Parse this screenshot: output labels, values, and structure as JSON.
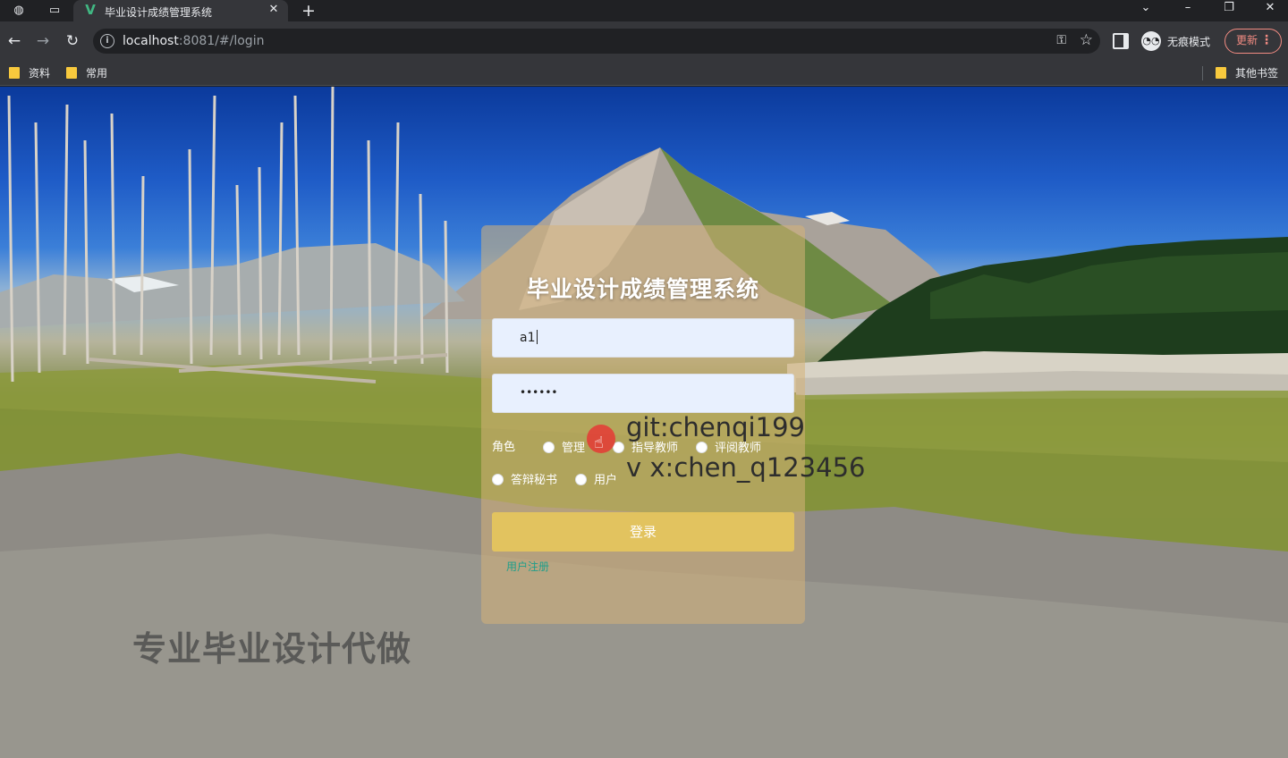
{
  "browser": {
    "tab_title": "毕业设计成绩管理系统",
    "url_host": "localhost",
    "url_rest": ":8081/#/login",
    "incognito_label": "无痕模式",
    "update_label": "更新",
    "bookmarks": [
      "资料",
      "常用"
    ],
    "other_bookmarks": "其他书签"
  },
  "login": {
    "title": "毕业设计成绩管理系统",
    "username_value": "a1",
    "password_value": "••••••",
    "role_label": "角色",
    "roles": [
      "管理",
      "指导教师",
      "评阅教师",
      "答辩秘书",
      "用户"
    ],
    "login_button": "登录",
    "register_link": "用户注册"
  },
  "watermarks": {
    "git": "git:chenqi199",
    "vx": "v x:chen_q123456",
    "ad": "专业毕业设计代做"
  },
  "colors": {
    "card": "#d6b278",
    "login_button": "#e6c65c",
    "register_link": "#1e9e8a",
    "input_bg": "#e8f0fe"
  }
}
